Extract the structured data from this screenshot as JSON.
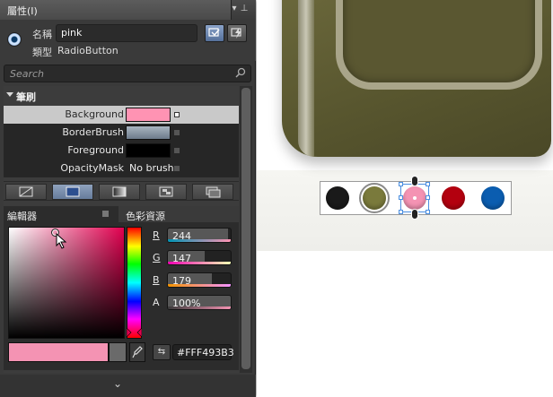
{
  "panel": {
    "title": "屬性(I)",
    "object": {
      "name_label": "名稱",
      "name_value": "pink",
      "type_label": "類型",
      "type_value": "RadioButton"
    },
    "search_placeholder": "Search",
    "category": "筆刷",
    "brush_properties": [
      {
        "name": "Background",
        "value_color": "#FF93B3",
        "selected": true
      },
      {
        "name": "BorderBrush",
        "value_color": "#8A98A8",
        "selected": false
      },
      {
        "name": "Foreground",
        "value_color": "#000000",
        "selected": false
      },
      {
        "name": "OpacityMask",
        "value_text": "No brush",
        "selected": false
      }
    ],
    "subtabs": {
      "editor": "編輯器",
      "resources": "色彩資源"
    },
    "color": {
      "r_label": "R",
      "r": "244",
      "g_label": "G",
      "g": "147",
      "b_label": "B",
      "b": "179",
      "a_label": "A",
      "a": "100%",
      "hex": "#FFF493B3",
      "current_swatch": "#F493B3",
      "hue_color": "#E1004F"
    }
  },
  "stage": {
    "radio_buttons": [
      {
        "name": "black",
        "color": "#1a1a1a"
      },
      {
        "name": "olive",
        "color": "#7a7a3c"
      },
      {
        "name": "pink",
        "color": "#F493B3",
        "selected": true
      },
      {
        "name": "red",
        "color": "#b3000f"
      },
      {
        "name": "blue",
        "color": "#0b5db0"
      }
    ]
  }
}
